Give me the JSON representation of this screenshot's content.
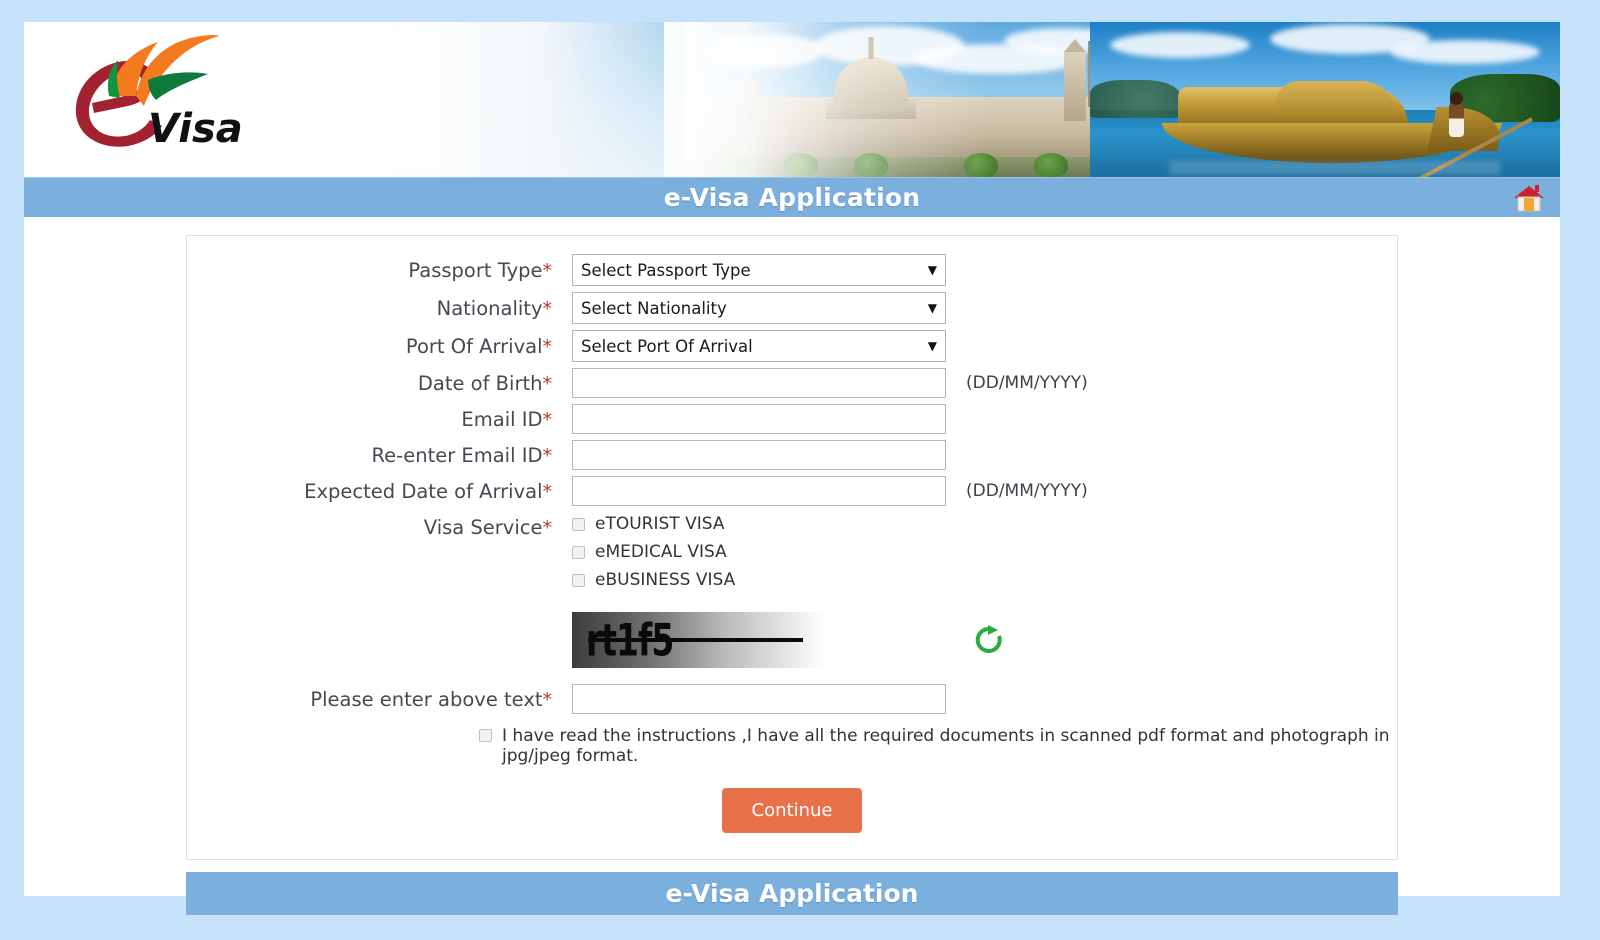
{
  "page": {
    "background_color": "#c7e2fb",
    "accent_blue": "#7bafdd",
    "button_orange": "#e8714a",
    "required_red": "#c0392b"
  },
  "header": {
    "logo_text": "Visa",
    "logo_letter": "e",
    "title": "e-Visa Application",
    "home_icon": "home-icon"
  },
  "form": {
    "fields": [
      {
        "id": "passport-type",
        "label": "Passport Type",
        "required": true,
        "type": "select",
        "value": "Select Passport Type",
        "hint": ""
      },
      {
        "id": "nationality",
        "label": "Nationality",
        "required": true,
        "type": "select",
        "value": "Select Nationality",
        "hint": ""
      },
      {
        "id": "port-of-arrival",
        "label": "Port Of Arrival",
        "required": true,
        "type": "select",
        "value": "Select Port Of Arrival",
        "hint": ""
      },
      {
        "id": "date-of-birth",
        "label": "Date of Birth",
        "required": true,
        "type": "text",
        "value": "",
        "hint": "(DD/MM/YYYY)"
      },
      {
        "id": "email-id",
        "label": "Email ID",
        "required": true,
        "type": "text",
        "value": "",
        "hint": ""
      },
      {
        "id": "re-enter-email-id",
        "label": "Re-enter Email ID",
        "required": true,
        "type": "text",
        "value": "",
        "hint": ""
      },
      {
        "id": "expected-date-of-arrival",
        "label": "Expected Date of Arrival",
        "required": true,
        "type": "text",
        "value": "",
        "hint": "(DD/MM/YYYY)"
      }
    ],
    "visa_service": {
      "label": "Visa Service",
      "required": true,
      "options": [
        {
          "id": "etourist",
          "label": "eTOURIST VISA",
          "checked": false
        },
        {
          "id": "emedical",
          "label": "eMEDICAL VISA",
          "checked": false
        },
        {
          "id": "ebusiness",
          "label": "eBUSINESS VISA",
          "checked": false
        }
      ]
    },
    "captcha": {
      "image_text": "rt1f5",
      "refresh_icon": "refresh-icon",
      "input_label": "Please enter above text",
      "input_required": true,
      "input_value": ""
    },
    "consent": {
      "checked": false,
      "text": "I have read the instructions ,I have all the required documents in scanned pdf format and photograph in jpg/jpeg format."
    },
    "submit_label": "Continue"
  },
  "footer": {
    "title": "e-Visa Application"
  }
}
